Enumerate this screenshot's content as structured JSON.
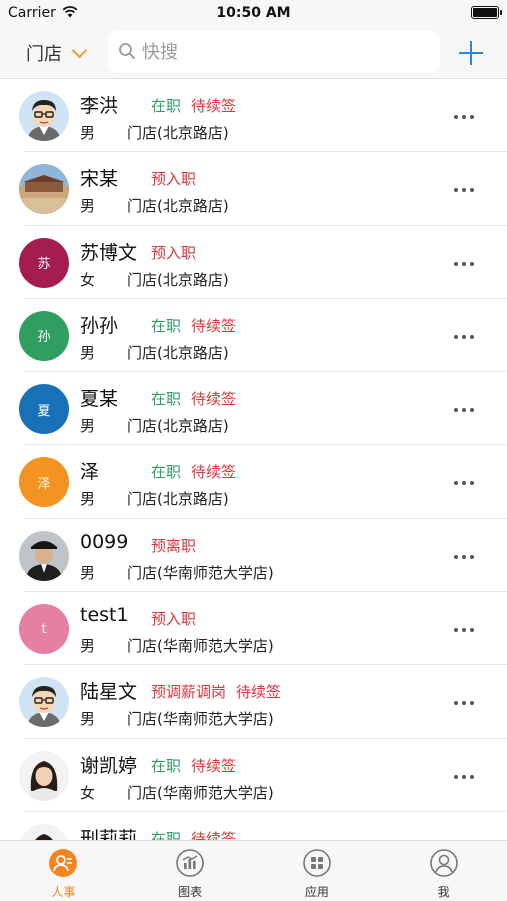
{
  "status_bar": {
    "carrier": "Carrier",
    "time": "10:50 AM"
  },
  "header": {
    "store_label": "门店",
    "search_placeholder": "快搜"
  },
  "colors": {
    "accent": "#f5831f",
    "blue": "#2f86d6",
    "status_green": "#2e9e66",
    "status_red": "#d9363e"
  },
  "employees": [
    {
      "name": "李洪",
      "gender": "男",
      "store": "门店(北京路店)",
      "tags": [
        {
          "text": "在职",
          "type": "green"
        },
        {
          "text": "待续签",
          "type": "red"
        }
      ],
      "avatar": {
        "kind": "cartoon"
      }
    },
    {
      "name": "宋某",
      "gender": "男",
      "store": "门店(北京路店)",
      "tags": [
        {
          "text": "预入职",
          "type": "red"
        }
      ],
      "avatar": {
        "kind": "photo-landscape"
      }
    },
    {
      "name": "苏博文",
      "gender": "女",
      "store": "门店(北京路店)",
      "tags": [
        {
          "text": "预入职",
          "type": "red"
        }
      ],
      "avatar": {
        "kind": "initial",
        "text": "苏",
        "color": "#a51d4f"
      }
    },
    {
      "name": "孙孙",
      "gender": "男",
      "store": "门店(北京路店)",
      "tags": [
        {
          "text": "在职",
          "type": "green"
        },
        {
          "text": "待续签",
          "type": "red"
        }
      ],
      "avatar": {
        "kind": "initial",
        "text": "孙",
        "color": "#2f9e5f"
      }
    },
    {
      "name": "夏某",
      "gender": "男",
      "store": "门店(北京路店)",
      "tags": [
        {
          "text": "在职",
          "type": "green"
        },
        {
          "text": "待续签",
          "type": "red"
        }
      ],
      "avatar": {
        "kind": "initial",
        "text": "夏",
        "color": "#1771b6"
      }
    },
    {
      "name": "泽",
      "gender": "男",
      "store": "门店(北京路店)",
      "tags": [
        {
          "text": "在职",
          "type": "green"
        },
        {
          "text": "待续签",
          "type": "red"
        }
      ],
      "avatar": {
        "kind": "initial",
        "text": "泽",
        "color": "#f39321"
      }
    },
    {
      "name": "0099",
      "gender": "男",
      "store": "门店(华南师范大学店)",
      "tags": [
        {
          "text": "预离职",
          "type": "red"
        }
      ],
      "avatar": {
        "kind": "photo-man"
      }
    },
    {
      "name": "test1",
      "gender": "男",
      "store": "门店(华南师范大学店)",
      "tags": [
        {
          "text": "预入职",
          "type": "red"
        }
      ],
      "avatar": {
        "kind": "initial",
        "text": "t",
        "color": "#e57fa4"
      }
    },
    {
      "name": "陆星文",
      "gender": "男",
      "store": "门店(华南师范大学店)",
      "tags": [
        {
          "text": "预调薪调岗",
          "type": "red"
        },
        {
          "text": "待续签",
          "type": "red"
        }
      ],
      "avatar": {
        "kind": "cartoon"
      }
    },
    {
      "name": "谢凯婷",
      "gender": "女",
      "store": "门店(华南师范大学店)",
      "tags": [
        {
          "text": "在职",
          "type": "green"
        },
        {
          "text": "待续签",
          "type": "red"
        }
      ],
      "avatar": {
        "kind": "photo-woman"
      }
    },
    {
      "name": "刑莉莉",
      "gender": "",
      "store": "",
      "tags": [
        {
          "text": "在职",
          "type": "green"
        },
        {
          "text": "待续签",
          "type": "red"
        }
      ],
      "avatar": {
        "kind": "photo-woman"
      }
    }
  ],
  "tabbar": {
    "tabs": [
      {
        "label": "人事",
        "icon": "person-icon",
        "active": true
      },
      {
        "label": "图表",
        "icon": "chart-icon",
        "active": false
      },
      {
        "label": "应用",
        "icon": "grid-icon",
        "active": false
      },
      {
        "label": "我",
        "icon": "profile-icon",
        "active": false
      }
    ]
  }
}
